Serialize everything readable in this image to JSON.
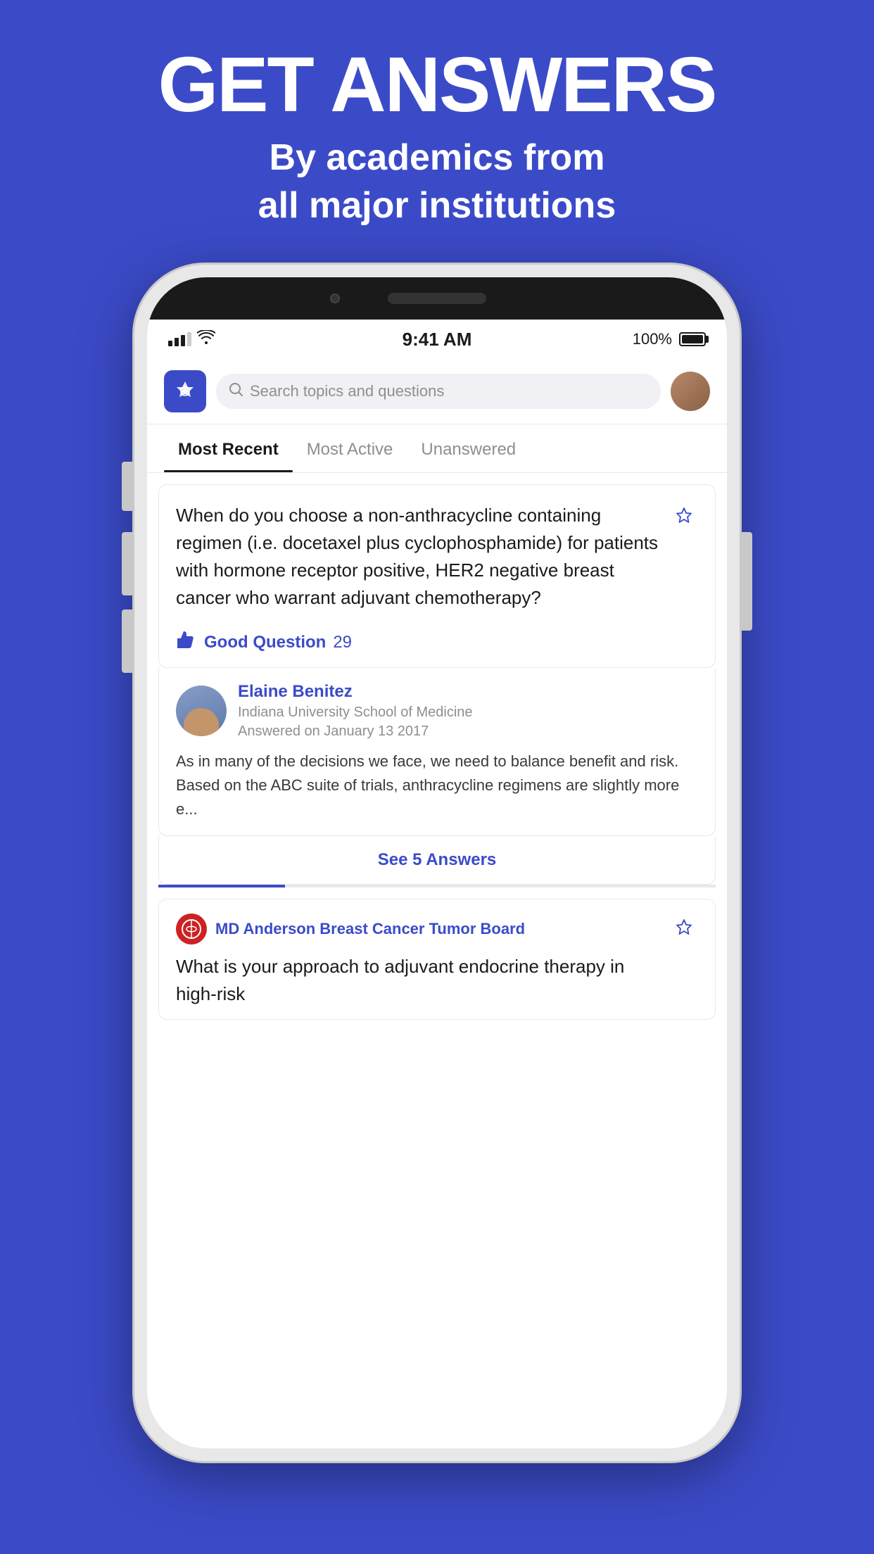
{
  "page": {
    "bg_color": "#3b4bc8",
    "headline": "GET ANSWERS",
    "subheadline": "By academics from\nall major institutions"
  },
  "status_bar": {
    "time": "9:41 AM",
    "battery": "100%",
    "signal_bars": [
      3,
      5,
      7,
      10,
      12
    ]
  },
  "search": {
    "placeholder": "Search topics and questions"
  },
  "tabs": [
    {
      "label": "Most Recent",
      "active": true
    },
    {
      "label": "Most Active",
      "active": false
    },
    {
      "label": "Unanswered",
      "active": false
    }
  ],
  "question1": {
    "text": "When do you choose a non-anthracycline containing regimen (i.e. docetaxel plus cyclophosphamide) for patients with hormone receptor positive, HER2 negative breast cancer who warrant adjuvant chemotherapy?",
    "good_question_label": "Good Question",
    "good_question_count": "29"
  },
  "answer1": {
    "name": "Elaine Benitez",
    "institution": "Indiana University School of Medicine",
    "date": "Answered on January 13 2017",
    "text": "As in many of the decisions we face, we need to balance benefit and risk. Based on the ABC suite of trials, anthracycline regimens are slightly more e...",
    "see_answers": "See 5 Answers"
  },
  "question2": {
    "org_name": "MD Anderson Breast Cancer Tumor Board",
    "text": "What is your approach to adjuvant endocrine therapy in high-risk"
  }
}
